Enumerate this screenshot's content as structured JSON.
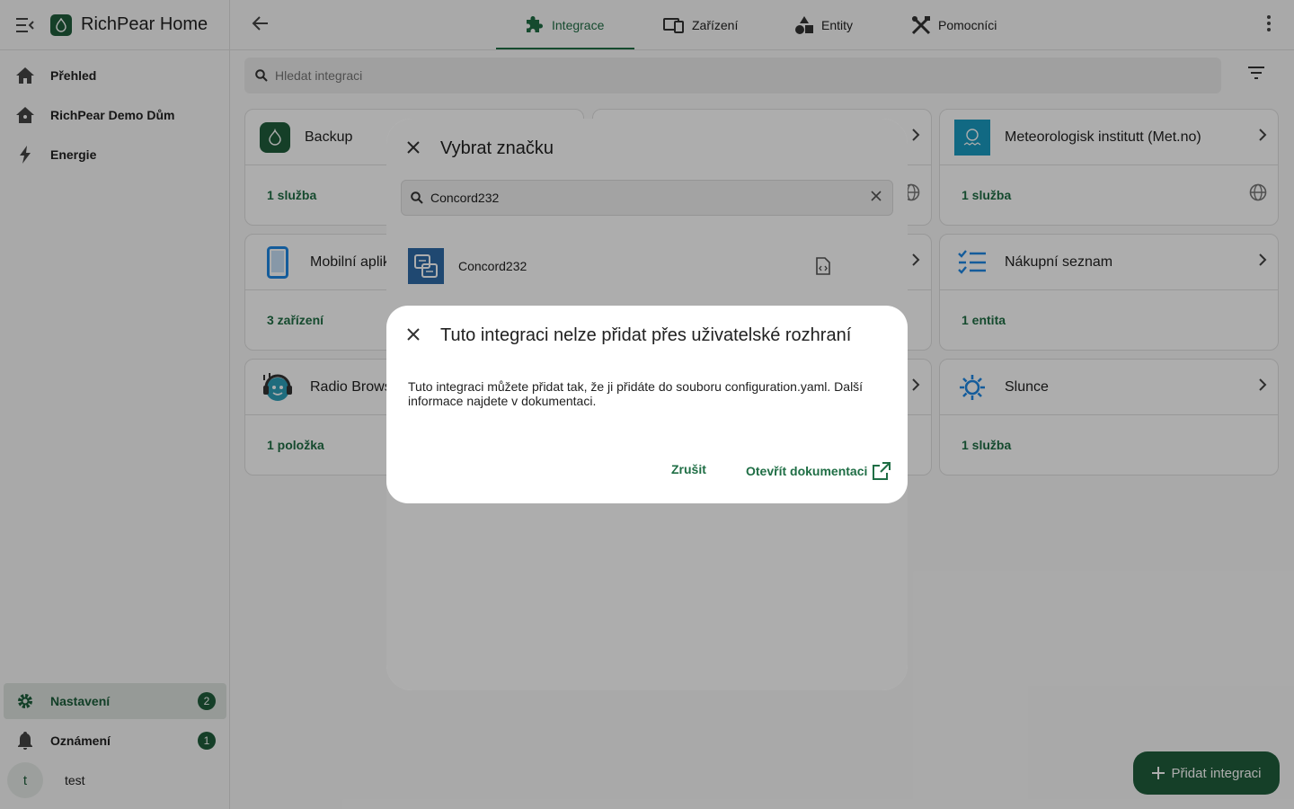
{
  "app": {
    "title": "RichPear Home"
  },
  "sidebar": {
    "items": [
      {
        "label": "Přehled"
      },
      {
        "label": "RichPear Demo Dům"
      },
      {
        "label": "Energie"
      }
    ],
    "bottom": [
      {
        "label": "Nastavení",
        "badge": "2"
      },
      {
        "label": "Oznámení",
        "badge": "1"
      }
    ],
    "user": {
      "initial": "t",
      "name": "test"
    }
  },
  "tabs": [
    {
      "label": "Integrace",
      "icon": "puzzle-icon"
    },
    {
      "label": "Zařízení",
      "icon": "devices-icon"
    },
    {
      "label": "Entity",
      "icon": "shapes-icon"
    },
    {
      "label": "Pomocníci",
      "icon": "tools-icon"
    }
  ],
  "search": {
    "placeholder": "Hledat integraci"
  },
  "cards": [
    {
      "name": "Backup",
      "footer": "1 služba"
    },
    {
      "name": "Meteorologisk institutt (Met.no)",
      "footer": "1 služba"
    },
    {
      "name": "Mobilní aplik",
      "footer": "3 zařízení"
    },
    {
      "name": "Nákupní seznam",
      "footer": "1 entita"
    },
    {
      "name": "Radio Brows",
      "footer": "1 položka"
    },
    {
      "name": "Slunce",
      "footer": "1 služba"
    }
  ],
  "fab": {
    "label": "Přidat integraci"
  },
  "brand_dialog": {
    "title": "Vybrat značku",
    "search_value": "Concord232",
    "results": [
      {
        "name": "Concord232"
      }
    ]
  },
  "info_dialog": {
    "title": "Tuto integraci nelze přidat přes uživatelské rozhraní",
    "body": "Tuto integraci můžete přidat tak, že ji přidáte do souboru configuration.yaml. Další informace najdete v dokumentaci.",
    "cancel_label": "Zrušit",
    "docs_label": "Otevřít dokumentaci"
  },
  "colors": {
    "accent": "#1f6e45",
    "brand": "#1f5e3b"
  }
}
